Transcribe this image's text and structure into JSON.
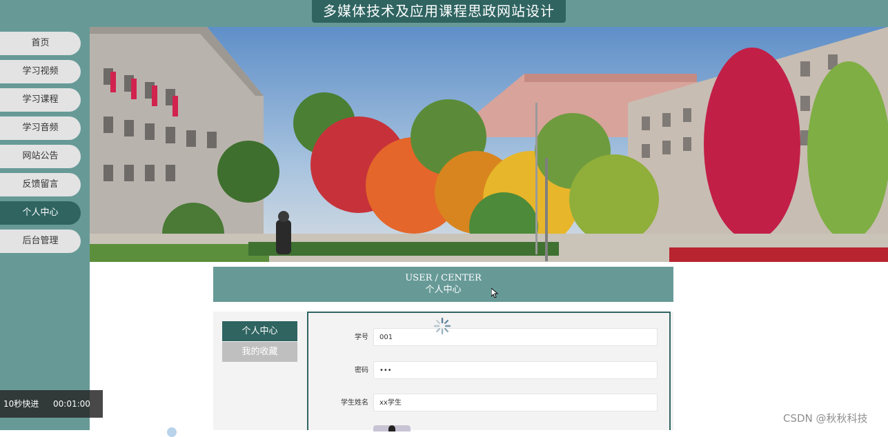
{
  "header": {
    "site_title": "多媒体技术及应用课程思政网站设计"
  },
  "nav": {
    "items": [
      {
        "label": "首页"
      },
      {
        "label": "学习视频"
      },
      {
        "label": "学习课程"
      },
      {
        "label": "学习音频"
      },
      {
        "label": "网站公告"
      },
      {
        "label": "反馈留言"
      },
      {
        "label": "个人中心"
      },
      {
        "label": "后台管理"
      }
    ],
    "active_label": "个人中心"
  },
  "user_center": {
    "title_en": "USER / CENTER",
    "title_cn": "个人中心",
    "tabs": [
      {
        "label": "个人中心"
      },
      {
        "label": "我的收藏"
      }
    ],
    "active_tab": "个人中心",
    "form": {
      "fields": [
        {
          "label": "学号",
          "value": "001"
        },
        {
          "label": "密码",
          "value": "•••"
        },
        {
          "label": "学生姓名",
          "value": "xx学生"
        }
      ]
    }
  },
  "video_overlay": {
    "fast_forward": "10秒快进",
    "time": "00:01:00"
  },
  "watermark": "CSDN @秋秋科技",
  "colors": {
    "primary_dark": "#2f6461",
    "primary": "#679a97",
    "nav_bg": "#e3e3e3",
    "tab_inactive": "#bfbfbf"
  },
  "icons": {
    "loading": "spinner-icon",
    "cursor": "mouse-cursor-icon"
  }
}
